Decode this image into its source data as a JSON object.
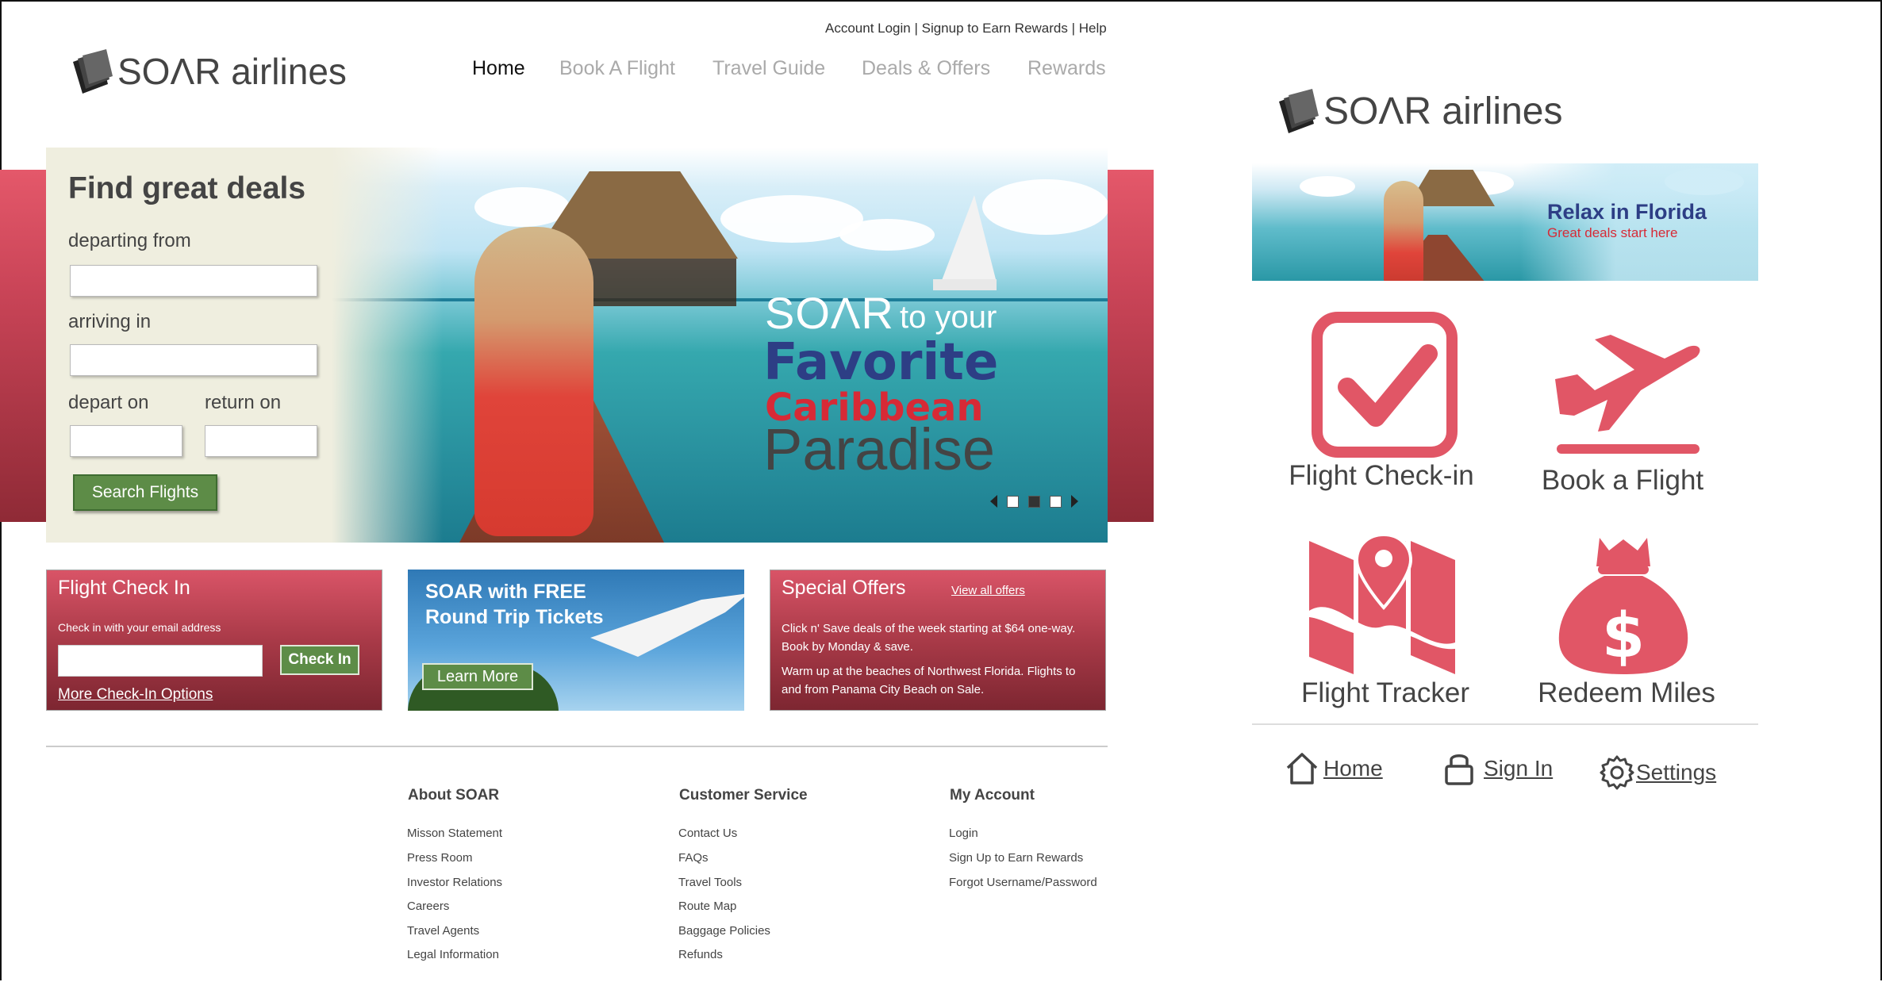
{
  "colors": {
    "accent_red": "#e15666",
    "button_green": "#5d8c47",
    "nav_inactive": "#aaaaaa",
    "navy": "#2d3e85"
  },
  "desktop": {
    "top_links": "Account Login | Signup to Earn Rewards | Help",
    "logo": {
      "wordmark": "SOΛR airlines",
      "icon": "stacked-wings-logo-icon"
    },
    "nav": [
      "Home",
      "Book A Flight",
      "Travel Guide",
      "Deals & Offers",
      "Rewards"
    ],
    "nav_active": "Home",
    "hero": {
      "search_title": "Find great deals",
      "departing_label": "departing from",
      "arriving_label": "arriving in",
      "depart_label": "depart on",
      "return_label": "return on",
      "search_button": "Search Flights",
      "headline_soar": "SOΛR",
      "headline_to_your": "to your",
      "headline_favorite": "Favorite",
      "headline_caribbean": "Caribbean",
      "headline_paradise": "Paradise",
      "carousel_active_index": 2,
      "carousel_count": 4
    },
    "checkin_card": {
      "title": "Flight Check In",
      "subtitle": "Check in with your email address",
      "button": "Check In",
      "link": "More Check-In Options"
    },
    "promo_card": {
      "title_line1": "SOAR with FREE",
      "title_line2": "Round Trip Tickets",
      "button": "Learn More"
    },
    "offers_card": {
      "title": "Special Offers",
      "link": "View all offers",
      "text1": "Click n' Save deals of the week starting at $64 one-way. Book by Monday & save.",
      "text2": "Warm up at the beaches of Northwest Florida. Flights to and from Panama City Beach on Sale."
    },
    "footer": {
      "col1": {
        "heading": "About SOAR",
        "links": [
          "Misson Statement",
          "Press Room",
          "Investor Relations",
          "Careers",
          "Travel Agents",
          "Legal Information"
        ]
      },
      "col2": {
        "heading": "Customer Service",
        "links": [
          "Contact Us",
          "FAQs",
          "Travel Tools",
          "Route Map",
          "Baggage Policies",
          "Refunds"
        ]
      },
      "col3": {
        "heading": "My Account",
        "links": [
          "Login",
          "Sign Up to Earn Rewards",
          "Forgot Username/Password"
        ]
      }
    }
  },
  "mobile": {
    "logo": {
      "wordmark": "SOΛR airlines",
      "icon": "stacked-wings-logo-icon"
    },
    "banner": {
      "title": "Relax in Florida",
      "subtitle": "Great deals start here"
    },
    "tiles": [
      {
        "label": "Flight Check-in",
        "icon": "checkbox-check-icon"
      },
      {
        "label": "Book a Flight",
        "icon": "airplane-takeoff-icon"
      },
      {
        "label": "Flight Tracker",
        "icon": "map-pin-icon"
      },
      {
        "label": "Redeem Miles",
        "icon": "money-bag-icon"
      }
    ],
    "bottom_nav": [
      {
        "label": "Home",
        "icon": "home-icon"
      },
      {
        "label": "Sign In",
        "icon": "lock-icon"
      },
      {
        "label": "Settings",
        "icon": "gear-icon"
      }
    ]
  }
}
